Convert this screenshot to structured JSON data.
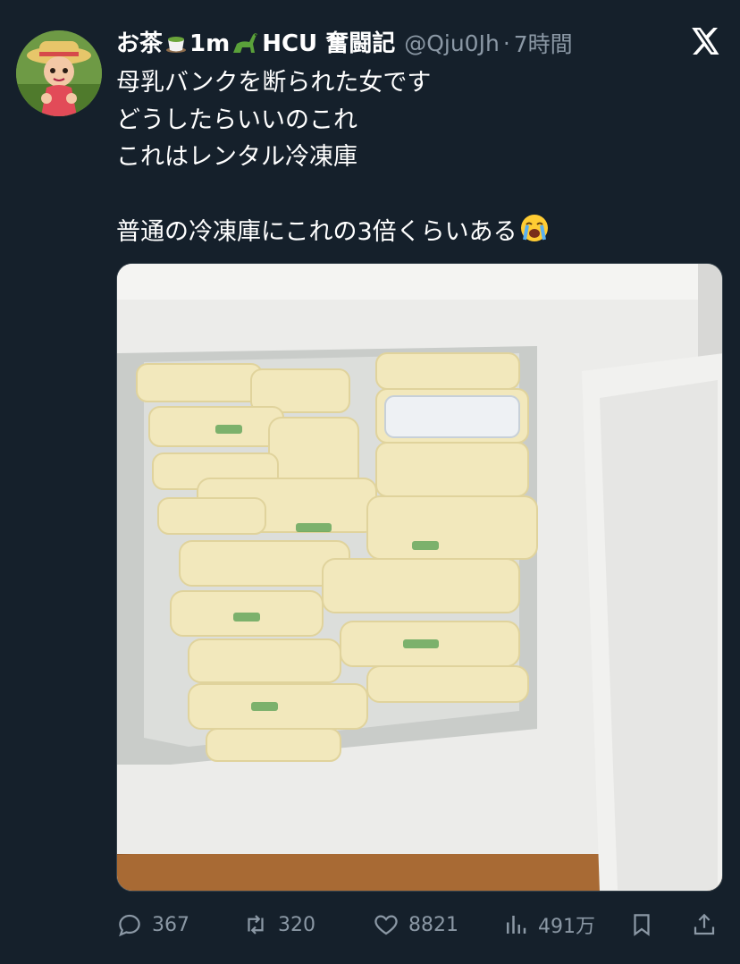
{
  "tweet": {
    "display_name": "お茶",
    "name_part2": "1m",
    "name_part3": "HCU 奮闘記",
    "handle": "@Qju0Jh",
    "separator": "·",
    "time": "7時間",
    "lines": [
      "母乳バンクを断られた女です",
      "どうしたらいいのこれ",
      "これはレンタル冷凍庫",
      "",
      "普通の冷凍庫にこれの3倍くらいある"
    ],
    "name_icons": [
      "tea-cup-emoji",
      "sauropod-emoji"
    ],
    "line_end_icon": "loudly-crying-face-emoji"
  },
  "actions": {
    "replies": "367",
    "retweets": "320",
    "likes": "8821",
    "views": "491万"
  },
  "colors": {
    "background": "#15202b",
    "text": "#ffffff",
    "muted": "#8b98a5"
  }
}
